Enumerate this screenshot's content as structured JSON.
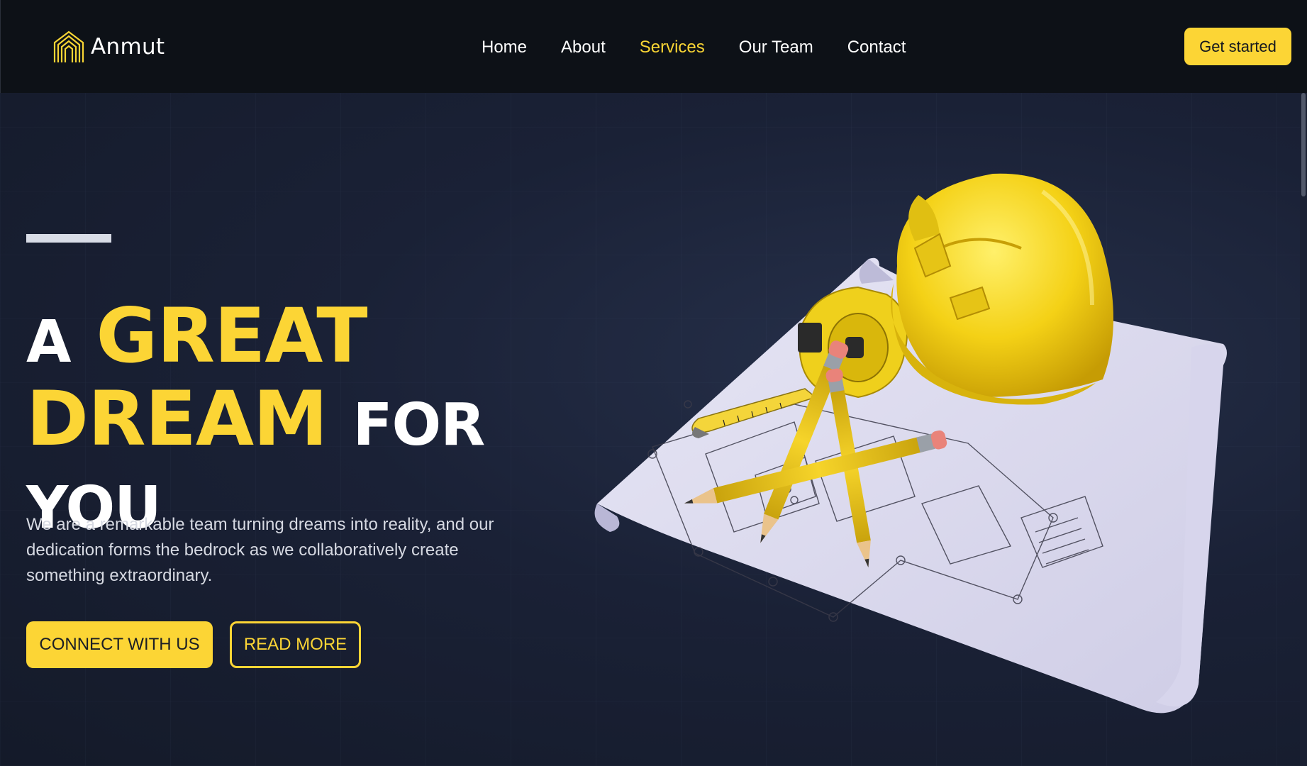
{
  "brand": {
    "name": "Anmut",
    "logo_icon": "arch-logo-icon"
  },
  "nav": {
    "items": [
      {
        "label": "Home",
        "active": false
      },
      {
        "label": "About",
        "active": false
      },
      {
        "label": "Services",
        "active": true
      },
      {
        "label": "Our Team",
        "active": false
      },
      {
        "label": "Contact",
        "active": false
      }
    ]
  },
  "header": {
    "cta_label": "Get started"
  },
  "hero": {
    "headline": {
      "word1": "A",
      "word2": "GREAT",
      "word3": "DREAM",
      "word4": "FOR",
      "word5": "YOU"
    },
    "tagline": "We are a remarkable team turning dreams into reality, and our dedication forms the bedrock as we collaboratively create something extraordinary.",
    "primary_button": "CONNECT WITH US",
    "secondary_button": "READ MORE",
    "illustration_icon": "hard-hat-blueprint-illustration"
  },
  "colors": {
    "accent": "#fcd535",
    "header_bg": "#0d1117",
    "hero_bg": "#1a2136",
    "text_light": "#ffffff"
  }
}
